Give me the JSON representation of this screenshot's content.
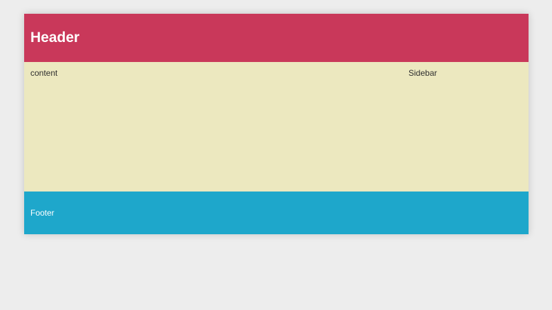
{
  "header": {
    "title": "Header"
  },
  "main": {
    "content_label": "content"
  },
  "sidebar": {
    "label": "Sidebar"
  },
  "footer": {
    "label": "Footer"
  },
  "colors": {
    "page_background": "#ededed",
    "header": "#c9385a",
    "content": "#ece8bf",
    "footer": "#1ea7cb"
  }
}
